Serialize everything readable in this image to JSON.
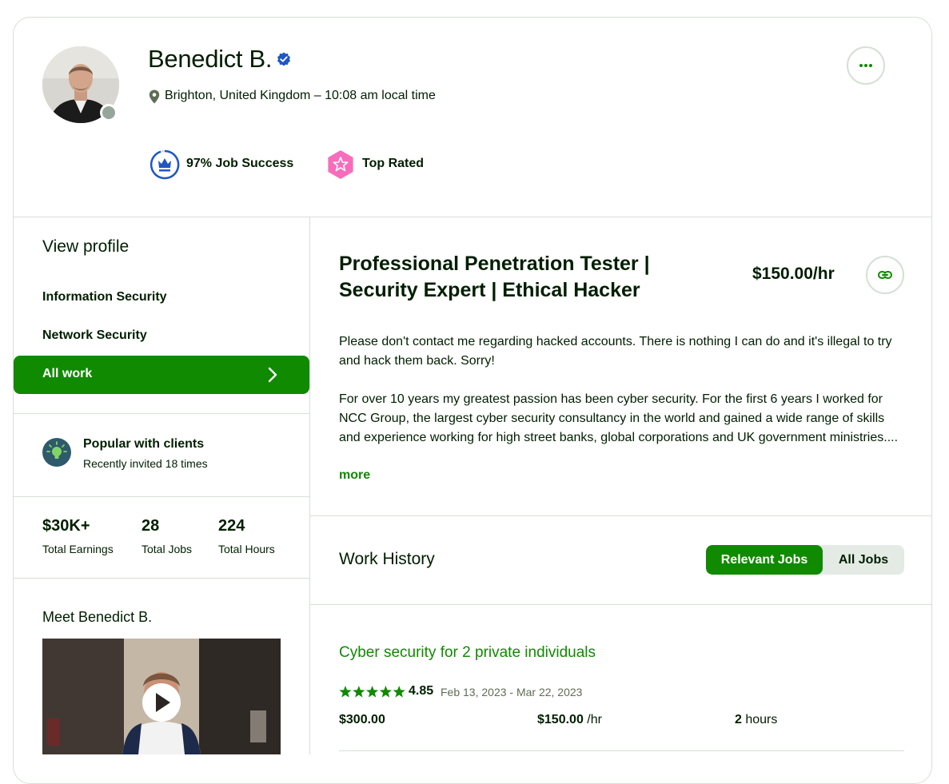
{
  "profile": {
    "name": "Benedict B.",
    "location": "Brighton, United Kingdom – 10:08 am local time",
    "badges": {
      "job_success": "97% Job Success",
      "top_rated": "Top Rated"
    }
  },
  "sidebar": {
    "title": "View profile",
    "items": [
      {
        "label": "Information Security"
      },
      {
        "label": "Network Security"
      },
      {
        "label": "All work"
      }
    ],
    "popular": {
      "title": "Popular with clients",
      "subtitle": "Recently invited 18 times"
    },
    "stats": [
      {
        "value": "$30K+",
        "label": "Total Earnings"
      },
      {
        "value": "28",
        "label": "Total Jobs"
      },
      {
        "value": "224",
        "label": "Total Hours"
      }
    ],
    "meet_title": "Meet Benedict B."
  },
  "main": {
    "headline": "Professional Penetration Tester | Security Expert | Ethical Hacker",
    "rate": "$150.00/hr",
    "description": [
      "Please don't contact me regarding hacked accounts. There is nothing I can do and it's illegal to try and hack them back. Sorry!",
      "For over 10 years my greatest passion has been cyber security. For the first 6 years I worked for NCC Group, the largest cyber security consultancy in the world and gained a wide range of skills and experience working for high street banks, global corporations and UK government ministries...."
    ],
    "more_label": "more"
  },
  "work_history": {
    "title": "Work History",
    "tabs": {
      "relevant": "Relevant Jobs",
      "all": "All Jobs"
    },
    "jobs": [
      {
        "title": "Cyber security for 2 private individuals",
        "rating": "4.85",
        "stars": 5,
        "dates": "Feb 13, 2023 - Mar 22, 2023",
        "earned": "$300.00",
        "rate": "$150.00",
        "rate_unit": "/hr",
        "hours": "2",
        "hours_unit": "hours"
      }
    ]
  },
  "colors": {
    "brand_green": "#108a00",
    "verified_blue": "#1f57c3",
    "top_rated_pink": "#f66dbc",
    "text_dark": "#001e00",
    "border": "#d5e0d5"
  },
  "icons": {
    "verified": "verified-check-icon",
    "location": "map-pin-icon",
    "more": "ellipsis-icon",
    "job_success": "crown-icon",
    "top_rated": "star-badge-icon",
    "chevron": "chevron-right-icon",
    "popular": "lightbulb-icon",
    "link": "link-icon",
    "play": "play-icon"
  }
}
